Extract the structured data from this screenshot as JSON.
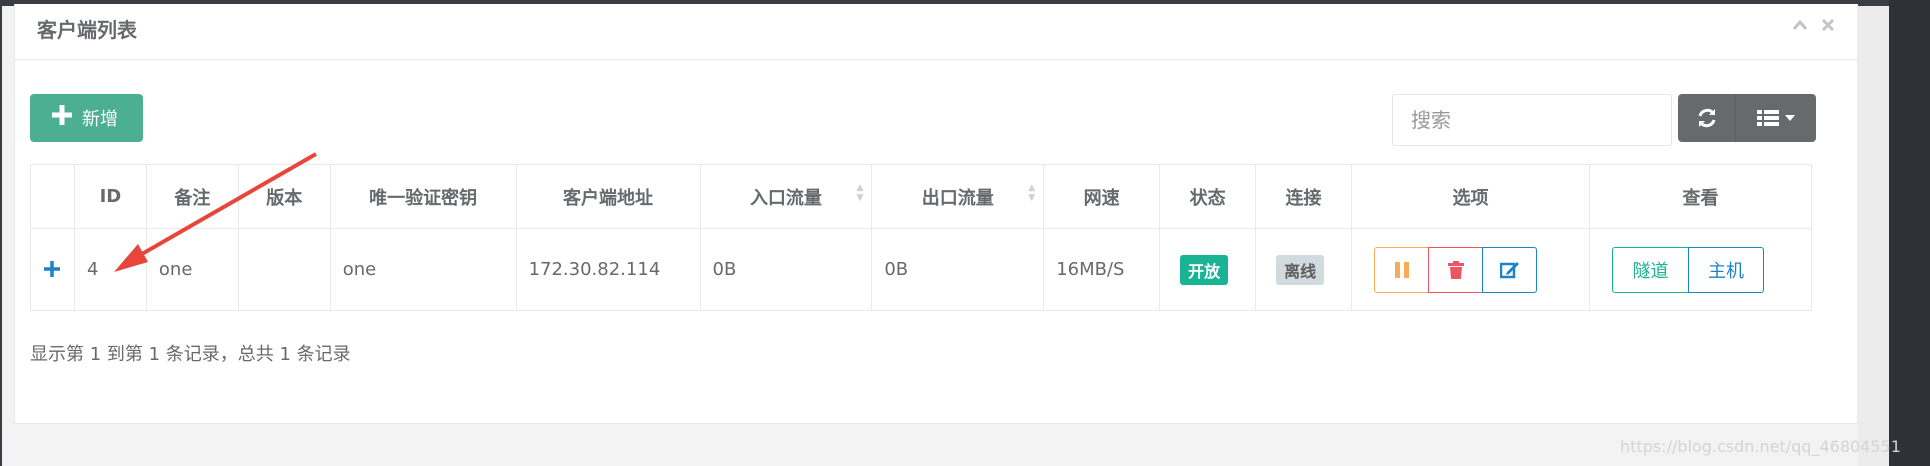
{
  "panel": {
    "title": "客户端列表"
  },
  "toolbar": {
    "add_label": "新增",
    "search_placeholder": "搜索"
  },
  "table": {
    "headers": [
      "ID",
      "备注",
      "版本",
      "唯一验证密钥",
      "客户端地址",
      "入口流量",
      "出口流量",
      "网速",
      "状态",
      "连接",
      "选项",
      "查看"
    ],
    "rows": [
      {
        "id": "4",
        "remark": "one",
        "version": "",
        "key": "one",
        "address": "172.30.82.114",
        "inflow": "0B",
        "outflow": "0B",
        "speed": "16MB/S",
        "status": "开放",
        "connection": "离线",
        "view_tunnel": "隧道",
        "view_host": "主机"
      }
    ]
  },
  "footer": {
    "info": "显示第 1 到第 1 条记录，总共 1 条记录"
  },
  "watermark": "https://blog.csdn.net/qq_46804551",
  "colors": {
    "add_button": "#4caf8f",
    "status_open": "#1ab394",
    "status_offline": "#d1dade",
    "pause": "#f8ac59",
    "delete": "#ed5565",
    "edit": "#1c84c6",
    "annotation_arrow": "#e8463b"
  },
  "icons": {
    "add": "plus-icon",
    "refresh": "refresh-icon",
    "columns": "list-icon",
    "expand": "plus-icon",
    "pause": "pause-icon",
    "delete": "trash-icon",
    "edit": "edit-icon",
    "collapse": "chevron-up-icon",
    "close": "close-icon"
  }
}
